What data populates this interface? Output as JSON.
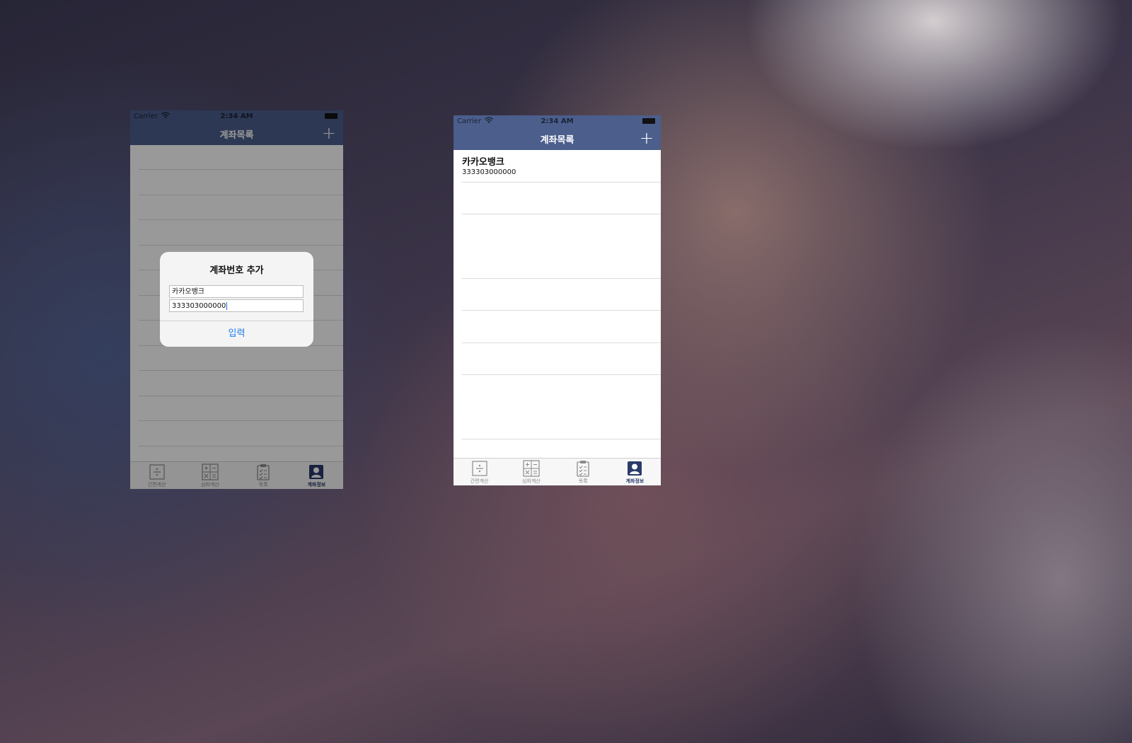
{
  "colors": {
    "nav_bar": "#4b5e8c",
    "tab_active": "#2a3a6a",
    "alert_button": "#1a7ef0"
  },
  "status_bar": {
    "carrier": "Carrier",
    "time": "2:34 AM"
  },
  "nav": {
    "title": "계좌목록",
    "add_icon": "plus-icon"
  },
  "alert": {
    "title": "계좌번호 추가",
    "bank_value": "카카오뱅크",
    "account_value": "333303000000",
    "submit_label": "입력"
  },
  "accounts": [
    {
      "bank": "카카오뱅크",
      "number": "333303000000"
    }
  ],
  "tabs": [
    {
      "label": "간편계산",
      "icon": "divide-icon"
    },
    {
      "label": "심화계산",
      "icon": "calculator-icon"
    },
    {
      "label": "목록",
      "icon": "clipboard-checklist-icon"
    },
    {
      "label": "계좌정보",
      "icon": "person-icon"
    }
  ],
  "active_tab_index": 3
}
